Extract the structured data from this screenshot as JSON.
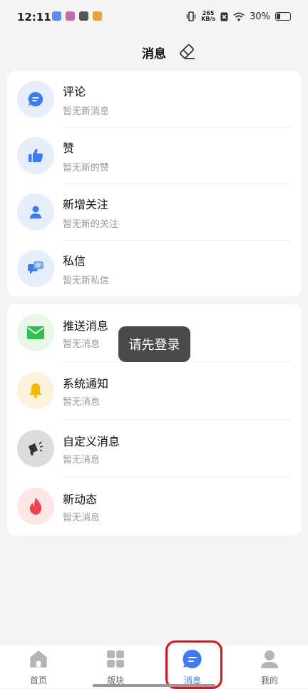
{
  "status": {
    "time": "12:11",
    "speed_value": "265",
    "speed_unit": "KB/s",
    "battery": "30%"
  },
  "header": {
    "title": "消息"
  },
  "interactions": [
    {
      "title": "评论",
      "subtitle": "暂无新消息",
      "icon": "comment-icon",
      "color": "#3b7cf5"
    },
    {
      "title": "赞",
      "subtitle": "暂无新的赞",
      "icon": "thumbs-up-icon",
      "color": "#3b7cf5"
    },
    {
      "title": "新增关注",
      "subtitle": "暂无新的关注",
      "icon": "person-icon",
      "color": "#3b7cf5"
    },
    {
      "title": "私信",
      "subtitle": "暂无新私信",
      "icon": "chat-bubbles-icon",
      "color": "#3b7cf5"
    }
  ],
  "notifications": [
    {
      "title": "推送消息",
      "subtitle": "暂无消息",
      "icon": "mail-icon",
      "color": "#2fbf4a"
    },
    {
      "title": "系统通知",
      "subtitle": "暂无消息",
      "icon": "bell-icon",
      "color": "#f5b700"
    },
    {
      "title": "自定义消息",
      "subtitle": "暂无消息",
      "icon": "megaphone-icon",
      "color": "#333333"
    },
    {
      "title": "新动态",
      "subtitle": "暂无消息",
      "icon": "flame-icon",
      "color": "#f0424a"
    }
  ],
  "toast": {
    "text": "请先登录"
  },
  "nav": [
    {
      "label": "首页",
      "icon": "home-icon"
    },
    {
      "label": "版块",
      "icon": "grid-icon"
    },
    {
      "label": "消息",
      "icon": "message-icon",
      "active": true
    },
    {
      "label": "我的",
      "icon": "profile-icon"
    }
  ],
  "colors": {
    "accent": "#3b7cf5",
    "highlight_border": "#e0141e",
    "background": "#f4f4f4"
  }
}
